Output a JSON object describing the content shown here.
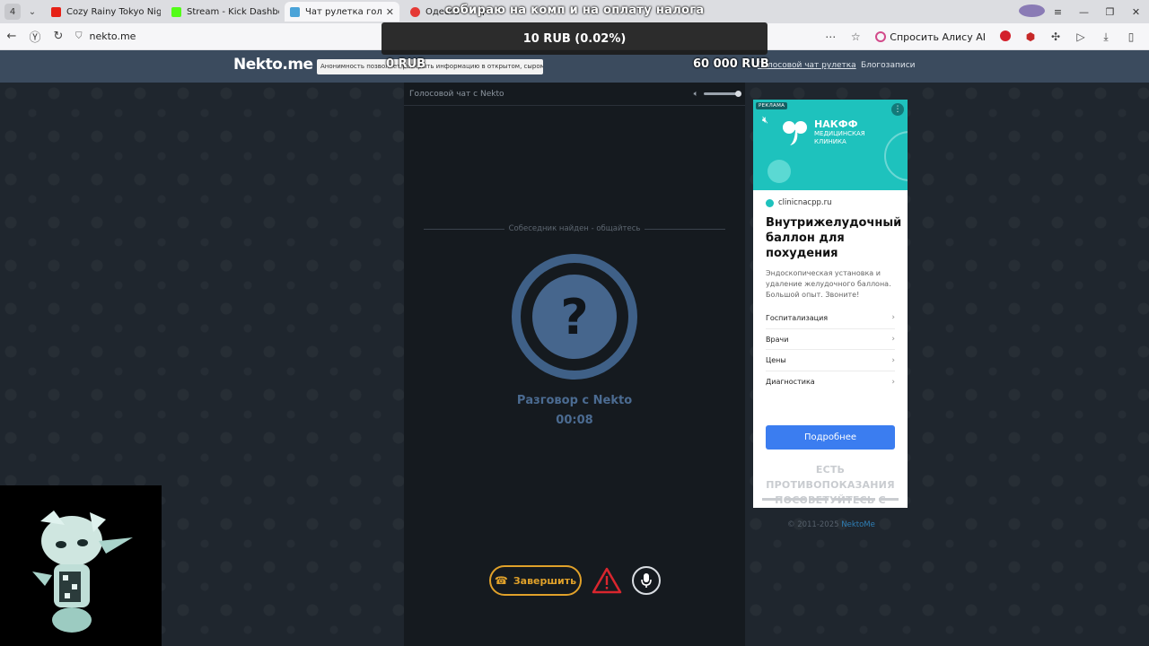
{
  "browser": {
    "tab_count": "4",
    "tabs": [
      {
        "title": "Cozy Rainy Tokyo Nights ...",
        "favicon_color": "#e62117"
      },
      {
        "title": "Stream - Kick Dashboard",
        "favicon_color": "#53fc18"
      },
      {
        "title": "Чат рулетка голосовая",
        "favicon_color": "#4aa3d8"
      },
      {
        "title": "Одесса",
        "favicon_color": "#e53935"
      }
    ],
    "window_controls": [
      "≡",
      "—",
      "❐",
      "✕"
    ],
    "url": "nekto.me",
    "ask_alice": "Спросить Алису AI"
  },
  "site": {
    "logo": "Nekto.me",
    "notice": "Анонимность позволяет раскрыть информацию в открытом, сыром виде!",
    "nav_voice_chat": "Голосовой чат рулетка",
    "nav_blog": "Блогозаписи"
  },
  "chat": {
    "title": "Голосовой чат с Nekto",
    "status": "Собеседник найден - общайтесь",
    "avatar_symbol": "?",
    "talk_label": "Разговор с Nekto",
    "timer": "00:08",
    "end_button": "Завершить"
  },
  "ad": {
    "tag": "РЕКЛАМА",
    "brand": "НАКФФ",
    "brand_sub": "МЕДИЦИНСКАЯ КЛИНИКА",
    "domain": "clinicnacpp.ru",
    "headline": "Внутрижелудочный баллон для похудения",
    "description": "Эндоскопическая установка и удаление желудочного баллона. Большой опыт. Звоните!",
    "links": [
      "Госпитализация",
      "Врачи",
      "Цены",
      "Диагностика"
    ],
    "cta": "Подробнее",
    "warning_line1": "ЕСТЬ ПРОТИВОПОКАЗАНИЯ",
    "warning_line2": "ПОСОВЕТУЙТЕСЬ С ВРАЧОМ"
  },
  "footer": {
    "copyright": "© 2011-2025",
    "brand_link": "NektoMe"
  },
  "overlay": {
    "goal_text": "собираю на комп и на оплату налога",
    "donation": "10 RUB (0.02%)",
    "goal_current": "0 RUB",
    "goal_target": "60 000 RUB"
  },
  "colors": {
    "accent_orange": "#e0a12a",
    "avatar_blue": "#46668d",
    "header_bg": "#3b4b5e",
    "ad_teal": "#1ec2bd",
    "cta_blue": "#3b7df0",
    "warning_red": "#d9262e"
  }
}
